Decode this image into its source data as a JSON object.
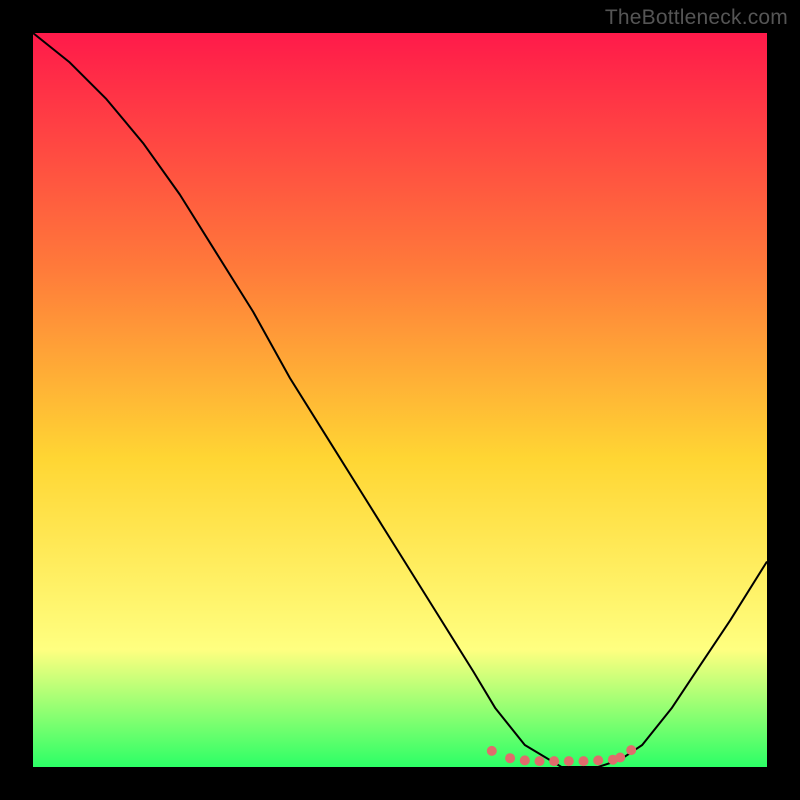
{
  "watermark": "TheBottleneck.com",
  "chart_data": {
    "type": "line",
    "title": "",
    "xlabel": "",
    "ylabel": "",
    "xlim": [
      0,
      100
    ],
    "ylim": [
      0,
      100
    ],
    "grid": false,
    "legend": false,
    "background_gradient": {
      "top": "#ff1a4a",
      "upper_mid": "#ff7a3a",
      "mid": "#ffd633",
      "lower_mid": "#ffff80",
      "bottom": "#2cff66"
    },
    "series": [
      {
        "name": "curve",
        "color": "#000000",
        "stroke_width": 2,
        "x": [
          0,
          5,
          10,
          15,
          20,
          25,
          30,
          35,
          40,
          45,
          50,
          55,
          60,
          63,
          67,
          72,
          77,
          80,
          83,
          87,
          91,
          95,
          100
        ],
        "values": [
          100,
          96,
          91,
          85,
          78,
          70,
          62,
          53,
          45,
          37,
          29,
          21,
          13,
          8,
          3,
          0,
          0,
          1,
          3,
          8,
          14,
          20,
          28
        ]
      }
    ],
    "markers": {
      "name": "bottom-dots",
      "color": "#e06c6c",
      "radius": 5,
      "x": [
        62.5,
        65,
        67,
        69,
        71,
        73,
        75,
        77,
        79,
        80,
        81.5
      ],
      "values": [
        2.2,
        1.2,
        0.9,
        0.8,
        0.8,
        0.8,
        0.8,
        0.9,
        1.0,
        1.3,
        2.3
      ]
    }
  }
}
